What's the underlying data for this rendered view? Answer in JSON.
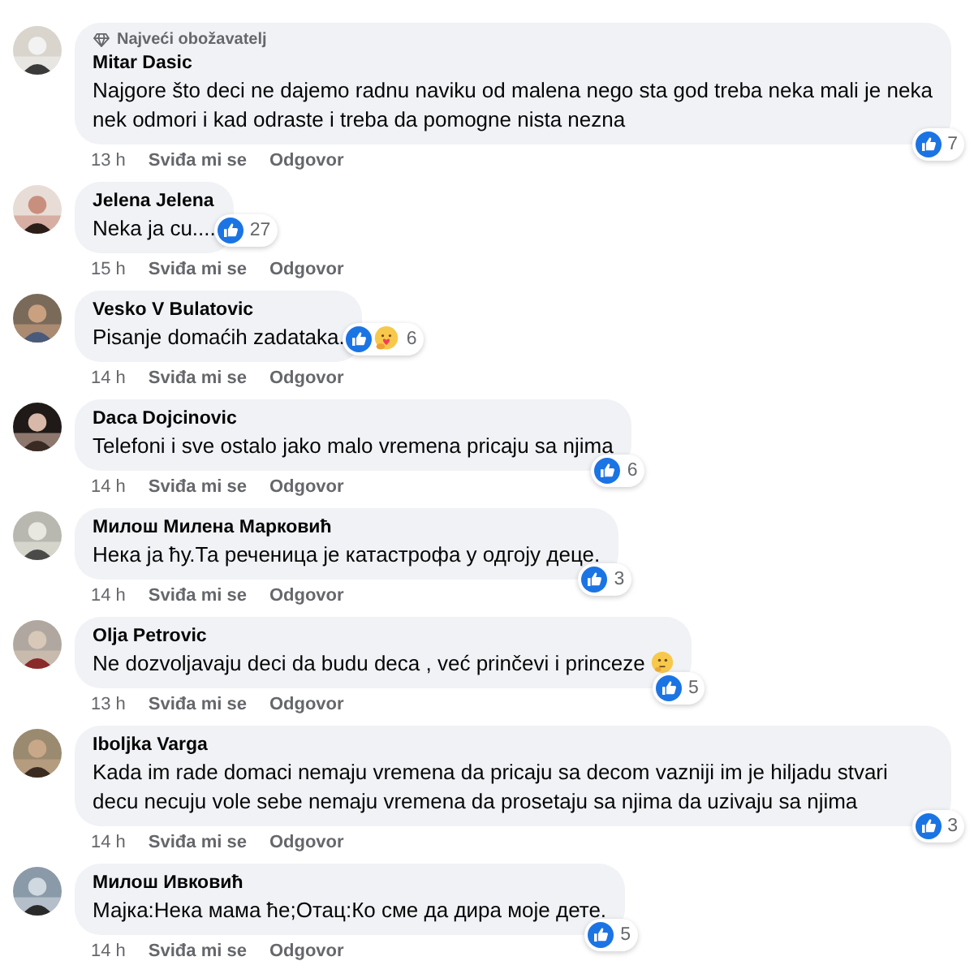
{
  "comments": [
    {
      "author": "Mitar Dasic",
      "badge": "Najveći obožavatelj",
      "text": "Najgore što deci ne dajemo radnu naviku od malena nego sta god treba neka mali je neka nek odmori i kad odraste i treba da pomogne nista nezna",
      "emoji": false,
      "time": "13 h",
      "like": "Sviđa mi se",
      "reply": "Odgovor",
      "reactions": [
        {
          "kind": "like"
        }
      ],
      "count": "7"
    },
    {
      "author": "Jelena Jelena",
      "text": "Neka ja cu....",
      "emoji": false,
      "time": "15 h",
      "like": "Sviđa mi se",
      "reply": "Odgovor",
      "reactions": [
        {
          "kind": "like"
        }
      ],
      "count": "27"
    },
    {
      "author": "Vesko V Bulatovic",
      "text": "Pisanje domaćih zadataka.",
      "emoji": false,
      "time": "14 h",
      "like": "Sviđa mi se",
      "reply": "Odgovor",
      "reactions": [
        {
          "kind": "like"
        },
        {
          "kind": "care"
        }
      ],
      "count": "6"
    },
    {
      "author": "Daca Dojcinovic",
      "text": "Telefoni i sve ostalo jako malo vremena pricaju sa njima",
      "emoji": false,
      "time": "14 h",
      "like": "Sviđa mi se",
      "reply": "Odgovor",
      "reactions": [
        {
          "kind": "like"
        }
      ],
      "count": "6"
    },
    {
      "author": "Милош Милена Марковић",
      "text": "Нека ја ћу.Та реченица је катастрофа у одгоју деце.",
      "emoji": false,
      "time": "14 h",
      "like": "Sviđa mi se",
      "reply": "Odgovor",
      "reactions": [
        {
          "kind": "like"
        }
      ],
      "count": "3"
    },
    {
      "author": "Olja Petrovic",
      "text": "Ne dozvoljavaju deci da budu deca , već prinčevi i princeze",
      "emoji": true,
      "time": "13 h",
      "like": "Sviđa mi se",
      "reply": "Odgovor",
      "reactions": [
        {
          "kind": "like"
        }
      ],
      "count": "5"
    },
    {
      "author": "Iboljka Varga",
      "text": "Kada im rade domaci nemaju vremena da pricaju sa decom vazniji im je hiljadu stvari decu necuju vole sebe nemaju vremena da prosetaju sa njima da uzivaju sa njima",
      "emoji": false,
      "time": "14 h",
      "like": "Sviđa mi se",
      "reply": "Odgovor",
      "reactions": [
        {
          "kind": "like"
        }
      ],
      "count": "3"
    },
    {
      "author": "Милош Ивковић",
      "text": "Мајка:Нека мама ће;Отац:Ко сме да дира моје дете.",
      "emoji": false,
      "time": "14 h",
      "like": "Sviđa mi se",
      "reply": "Odgovor",
      "reactions": [
        {
          "kind": "like"
        }
      ],
      "count": "5"
    }
  ]
}
